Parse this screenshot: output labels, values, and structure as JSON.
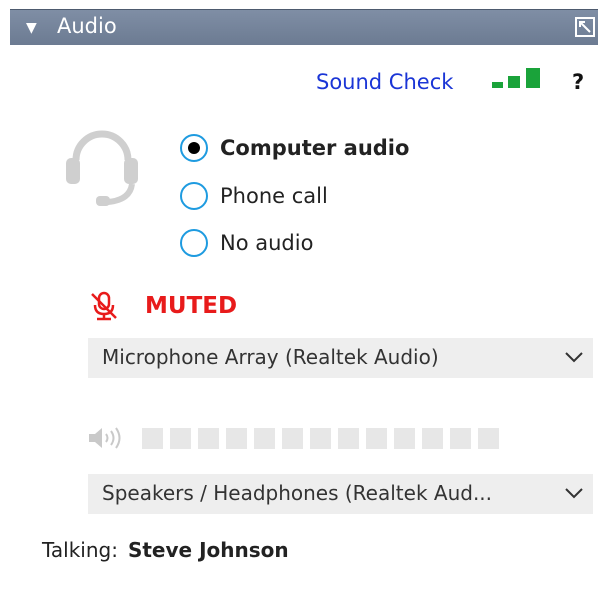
{
  "panel": {
    "title": "Audio",
    "caret_glyph": "▼"
  },
  "toolbar": {
    "sound_check_label": "Sound Check",
    "help_label": "?",
    "signal_bars_filled": 3,
    "signal_color": "#1aa33a"
  },
  "audio_options": {
    "options": [
      {
        "label": "Computer audio",
        "selected": true
      },
      {
        "label": "Phone call",
        "selected": false
      },
      {
        "label": "No audio",
        "selected": false
      }
    ]
  },
  "microphone": {
    "status_label": "MUTED",
    "status_color": "#e81b1b",
    "device": "Microphone Array (Realtek Audio)"
  },
  "speaker": {
    "level_segments": 13,
    "level_active": 0,
    "device": "Speakers / Headphones (Realtek Aud..."
  },
  "talking": {
    "label": "Talking:",
    "name": "Steve Johnson"
  },
  "icons": [
    "caret-down-icon",
    "popout-icon",
    "signal-bars-icon",
    "headset-icon",
    "muted-mic-icon",
    "chevron-down-icon",
    "speaker-icon"
  ]
}
